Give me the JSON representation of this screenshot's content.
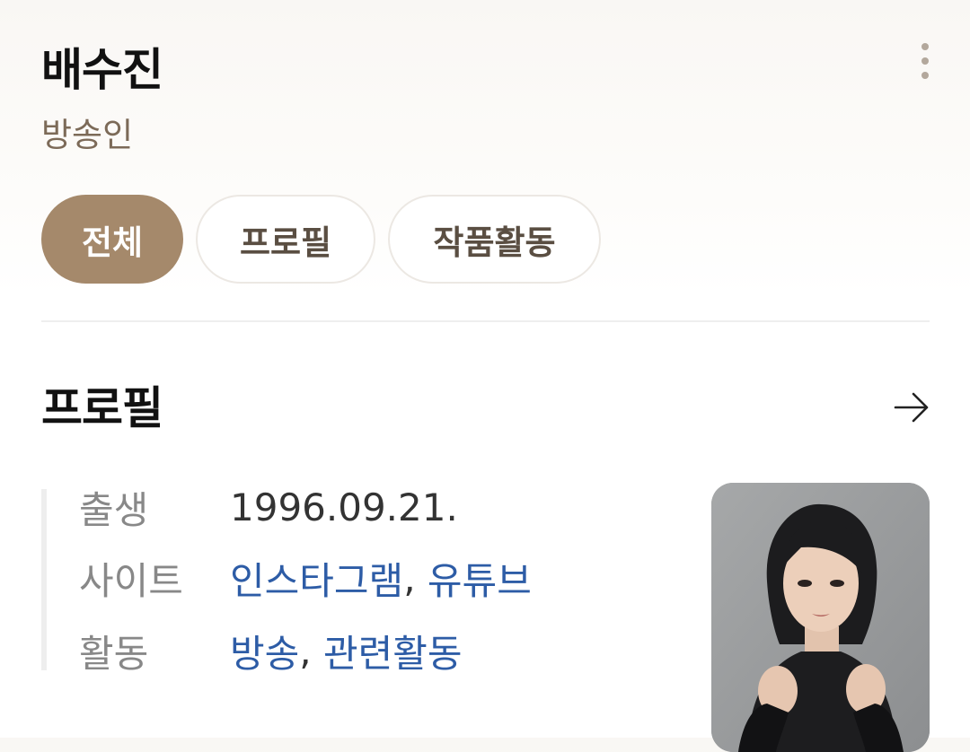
{
  "header": {
    "name": "배수진",
    "occupation": "방송인"
  },
  "tabs": [
    {
      "label": "전체",
      "active": true
    },
    {
      "label": "프로필",
      "active": false
    },
    {
      "label": "작품활동",
      "active": false
    }
  ],
  "profile": {
    "section_title": "프로필",
    "rows": {
      "birth": {
        "label": "출생",
        "value": "1996.09.21."
      },
      "site": {
        "label": "사이트",
        "links": [
          "인스타그램",
          "유튜브"
        ]
      },
      "activity": {
        "label": "활동",
        "links": [
          "방송",
          "관련활동"
        ]
      }
    },
    "separator": ","
  },
  "colors": {
    "accent": "#a5896b",
    "link": "#2d5ca6",
    "subtitle": "#7c6a58"
  },
  "icons": [
    "more-vertical-icon",
    "arrow-right-icon"
  ]
}
